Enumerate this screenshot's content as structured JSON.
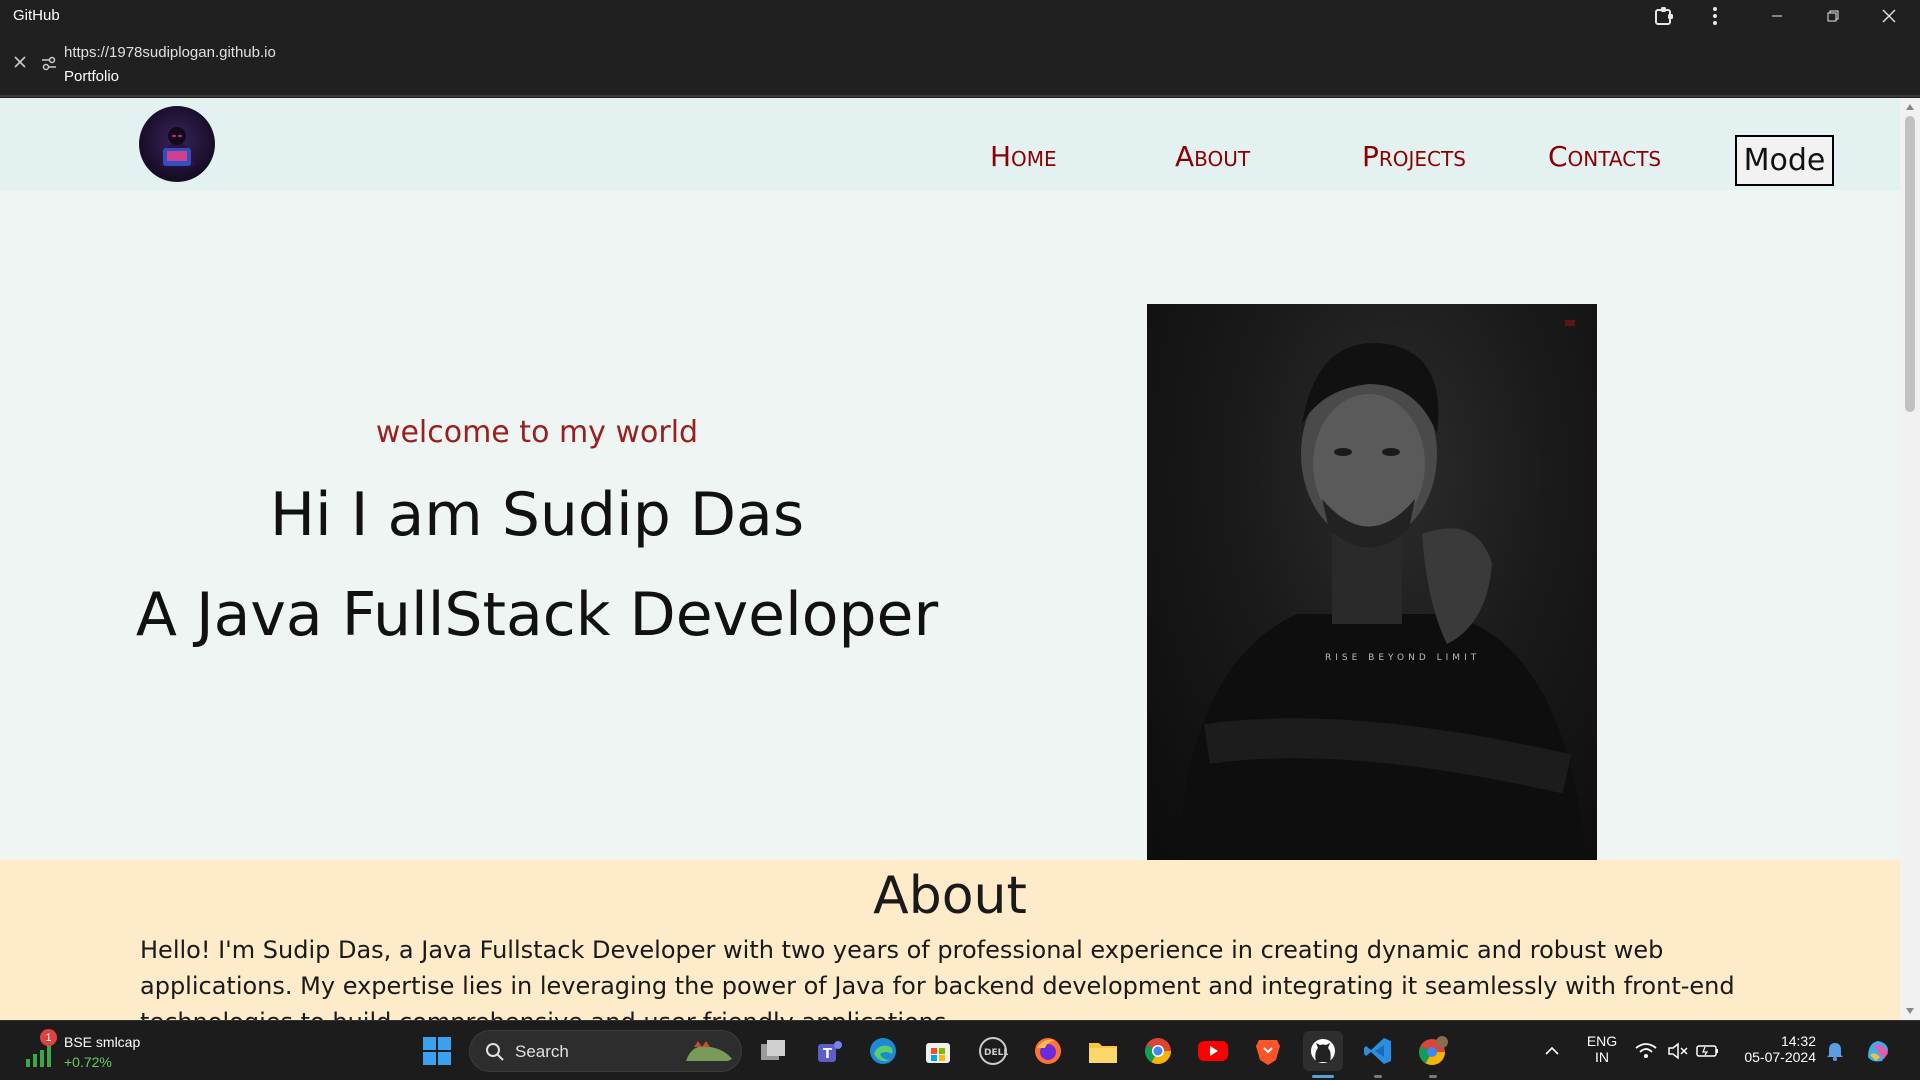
{
  "window": {
    "app_title": "GitHub"
  },
  "browser": {
    "url": "https://1978sudiplogan.github.io",
    "page_title": "Portfolio"
  },
  "nav": {
    "links": [
      "Home",
      "About",
      "Projects",
      "Contacts"
    ],
    "mode_label": "Mode"
  },
  "hero": {
    "welcome": "welcome to my world",
    "name_line": "Hi I am Sudip Das",
    "role_line": "A Java FullStack Developer",
    "portrait_shirt_text": "RISE BEYOND LIMIT"
  },
  "about": {
    "title": "About",
    "text": "Hello! I'm Sudip Das, a Java Fullstack Developer with two years of professional experience in creating dynamic and robust web applications. My expertise lies in leveraging the power of Java for backend development and integrating it seamlessly with front-end technologies to build comprehensive and user-friendly applications."
  },
  "taskbar": {
    "stock_name": "BSE smlcap",
    "stock_change": "+0.72%",
    "stock_badge": "1",
    "search_label": "Search",
    "lang_top": "ENG",
    "lang_bottom": "IN",
    "time": "14:32",
    "date": "05-07-2024",
    "icons": [
      "windows-start-icon",
      "task-view-icon",
      "teams-icon",
      "edge-icon",
      "store-icon",
      "dell-icon",
      "firefox-icon",
      "file-explorer-icon",
      "chrome-icon",
      "youtube-icon",
      "brave-icon",
      "github-icon",
      "vscode-icon",
      "chrome-profile-icon"
    ]
  },
  "colors": {
    "nav_link": "#8b0000",
    "welcome": "#9a2020",
    "about_bg": "#fdebc9",
    "page_bg": "#eef5f2",
    "navbar_bg": "#e3f1f0"
  }
}
